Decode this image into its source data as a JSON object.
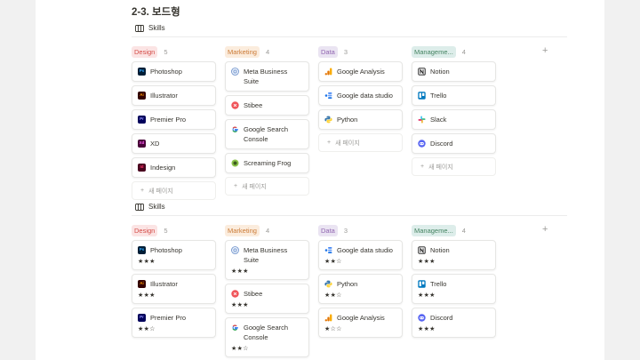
{
  "page": {
    "title": "2-3. 보드형"
  },
  "views": [
    {
      "tab_label": "Skills",
      "add_column": "+",
      "new_page_label": "새 페이지",
      "columns": [
        {
          "label": "Design",
          "count": "5",
          "bg": "#fbe4e4",
          "fg": "#d44c47",
          "cards": [
            {
              "title": "Photoshop",
              "icon": "photoshop-icon"
            },
            {
              "title": "Illustrator",
              "icon": "illustrator-icon"
            },
            {
              "title": "Premier Pro",
              "icon": "premiere-pro-icon"
            },
            {
              "title": "XD",
              "icon": "xd-icon"
            },
            {
              "title": "Indesign",
              "icon": "indesign-icon"
            }
          ],
          "show_new": true
        },
        {
          "label": "Marketing",
          "count": "4",
          "bg": "#fbecdd",
          "fg": "#cb7b37",
          "cards": [
            {
              "title": "Meta Business Suite",
              "icon": "meta-business-icon"
            },
            {
              "title": "Stibee",
              "icon": "stibee-icon"
            },
            {
              "title": "Google Search Console",
              "icon": "google-icon"
            },
            {
              "title": "Screaming Frog",
              "icon": "screaming-frog-icon"
            }
          ],
          "show_new": true
        },
        {
          "label": "Data",
          "count": "3",
          "bg": "#eae4f2",
          "fg": "#9065b0",
          "cards": [
            {
              "title": "Google Analysis",
              "icon": "google-analytics-icon"
            },
            {
              "title": "Google data studio",
              "icon": "data-studio-icon"
            },
            {
              "title": "Python",
              "icon": "python-icon"
            }
          ],
          "show_new": true
        },
        {
          "label": "Manageme...",
          "count": "4",
          "bg": "#ddedea",
          "fg": "#448361",
          "cards": [
            {
              "title": "Notion",
              "icon": "notion-icon"
            },
            {
              "title": "Trello",
              "icon": "trello-icon"
            },
            {
              "title": "Slack",
              "icon": "slack-icon"
            },
            {
              "title": "Discord",
              "icon": "discord-icon"
            }
          ],
          "show_new": true
        }
      ]
    },
    {
      "tab_label": "Skills",
      "add_column": "+",
      "new_page_label": "",
      "columns": [
        {
          "label": "Design",
          "count": "5",
          "bg": "#fbe4e4",
          "fg": "#d44c47",
          "cards": [
            {
              "title": "Photoshop",
              "icon": "photoshop-icon",
              "stars": "★★★"
            },
            {
              "title": "Illustrator",
              "icon": "illustrator-icon",
              "stars": "★★★"
            },
            {
              "title": "Premier Pro",
              "icon": "premiere-pro-icon",
              "stars": "★★☆"
            }
          ],
          "show_new": false
        },
        {
          "label": "Marketing",
          "count": "4",
          "bg": "#fbecdd",
          "fg": "#cb7b37",
          "cards": [
            {
              "title": "Meta Business Suite",
              "icon": "meta-business-icon",
              "stars": "★★★"
            },
            {
              "title": "Stibee",
              "icon": "stibee-icon",
              "stars": "★★★"
            },
            {
              "title": "Google Search Console",
              "icon": "google-icon",
              "stars": "★★☆"
            }
          ],
          "show_new": false
        },
        {
          "label": "Data",
          "count": "3",
          "bg": "#eae4f2",
          "fg": "#9065b0",
          "cards": [
            {
              "title": "Google data studio",
              "icon": "data-studio-icon",
              "stars": "★★☆"
            },
            {
              "title": "Python",
              "icon": "python-icon",
              "stars": "★★☆"
            },
            {
              "title": "Google Analysis",
              "icon": "google-analytics-icon",
              "stars": "★☆☆"
            }
          ],
          "show_new": false
        },
        {
          "label": "Manageme...",
          "count": "4",
          "bg": "#ddedea",
          "fg": "#448361",
          "cards": [
            {
              "title": "Notion",
              "icon": "notion-icon",
              "stars": "★★★"
            },
            {
              "title": "Trello",
              "icon": "trello-icon",
              "stars": "★★★"
            },
            {
              "title": "Discord",
              "icon": "discord-icon",
              "stars": "★★★"
            }
          ],
          "show_new": false
        }
      ]
    }
  ]
}
